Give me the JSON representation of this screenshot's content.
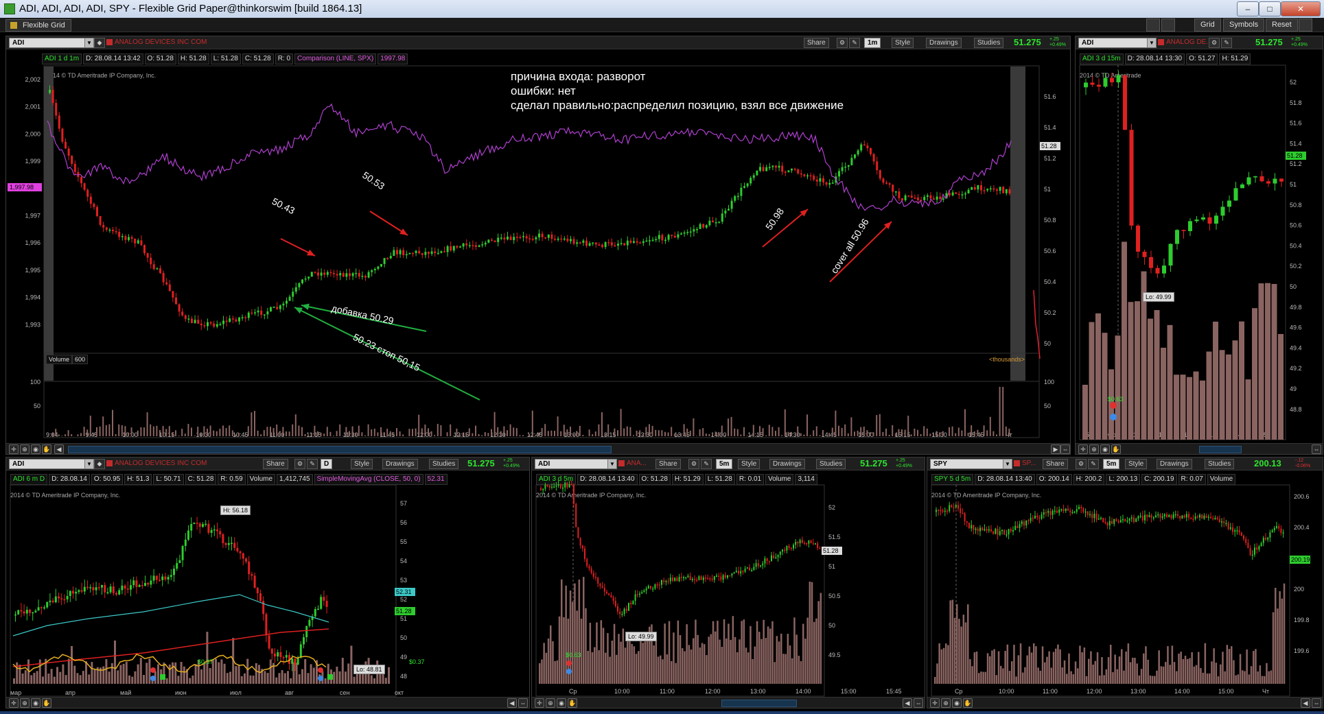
{
  "window": {
    "title": "ADI, ADI, ADI, ADI, SPY - Flexible Grid Paper@thinkorswim [build 1864.13]",
    "minimize": "–",
    "maximize": "□",
    "close": "✕",
    "icon": "thinkorswim-icon"
  },
  "toolbar": {
    "tab": "Flexible Grid",
    "buttons": [
      "Grid",
      "Symbols",
      "Reset"
    ]
  },
  "common": {
    "share": "Share",
    "style": "Style",
    "drawings": "Drawings",
    "studies": "Studies",
    "company": "ANALOG DEVICES INC COM"
  },
  "panels": {
    "main": {
      "symbol": "ADI",
      "aggregation": "1m",
      "price": "51.275",
      "change": "+.25",
      "change_pct": "+0.49%",
      "header": [
        "ADI 1 d 1m",
        "D: 28.08.14 13:42",
        "O: 51.28",
        "H: 51.28",
        "L: 51.28",
        "C: 51.28",
        "R: 0"
      ],
      "comparison": "Comparison (LINE, SPX)",
      "comparison_value": "1997.98",
      "copyright": "2014 © TD Ameritrade IP Company, Inc.",
      "left_axis": [
        "2,002",
        "2,001",
        "2,000",
        "1,999",
        "1,998",
        "1,997",
        "1,996",
        "1,995",
        "1,994",
        "1,993"
      ],
      "left_marker": "1,997.98",
      "right_axis": [
        "51.6",
        "51.4",
        "51.2",
        "51",
        "50.8",
        "50.6",
        "50.4",
        "50.2",
        "50"
      ],
      "right_marker": "51.28",
      "volume_label": "Volume",
      "volume_value": "600",
      "volume_units": "<thousands>",
      "volume_axis": [
        "100",
        "50"
      ],
      "time_axis": [
        "9:04",
        "9:45",
        "10:00",
        "10:15",
        "10:30",
        "10:45",
        "11:00",
        "11:15",
        "11:30",
        "11:45",
        "12:00",
        "12:15",
        "12:30",
        "12:45",
        "13:00",
        "13:15",
        "13:30",
        "13:45",
        "14:00",
        "14:15",
        "14:30",
        "14:45",
        "15:00",
        "15:15",
        "15:30",
        "15:45",
        "Чт"
      ],
      "annotation": [
        "причина входа: разворот",
        "ошибки: нет",
        "сделал правильно:распределил позицию, взял все движение"
      ],
      "arrow_labels": [
        "50.53",
        "50.43",
        "добавка 50.29",
        "50.23 стоп 50,15",
        "50.98",
        "cover all 50.96"
      ]
    },
    "right": {
      "symbol": "ADI",
      "company": "ANALOG DE...",
      "price": "51.275",
      "change": "+.25",
      "change_pct": "+0.49%",
      "header": [
        "ADI 3 d 15m",
        "D: 28.08.14 13:30",
        "O: 51.27",
        "H: 51.29"
      ],
      "copyright": "2014 © TD Ameritrade",
      "right_axis": [
        "52",
        "51.8",
        "51.6",
        "51.4",
        "51.2",
        "51",
        "50.8",
        "50.6",
        "50.4",
        "50.2",
        "50",
        "49.8",
        "49.6",
        "49.4",
        "49.2",
        "49",
        "48.8"
      ],
      "marker": "51.28",
      "lo": "Lo: 49.99",
      "dividend": "$0.63",
      "time_axis": [
        "15",
        "Ср",
        "10",
        "11",
        "12",
        "13",
        "14",
        "15"
      ]
    },
    "bl": {
      "symbol": "ADI",
      "aggregation": "D",
      "price": "51.275",
      "change": "+.25",
      "change_pct": "+0.49%",
      "header": [
        "ADI 6 m D",
        "D: 28.08.14",
        "O: 50.95",
        "H: 51.3",
        "L: 50.71",
        "C: 51.28",
        "R: 0.59",
        "Volume",
        "1,412,745"
      ],
      "sma": "SimpleMovingAvg (CLOSE, 50, 0)",
      "sma_value": "52.31",
      "copyright": "2014 © TD Ameritrade IP Company, Inc.",
      "right_axis": [
        "57",
        "56",
        "55",
        "54",
        "53",
        "52",
        "51",
        "50",
        "49",
        "48"
      ],
      "marker1": "52.31",
      "marker2": "51.28",
      "hi": "Hi: 56.18",
      "lo": "Lo: 48.81",
      "div1": "$0.37",
      "div2": "$0.37",
      "time_axis": [
        "мар",
        "апр",
        "май",
        "июн",
        "июл",
        "авг",
        "сен",
        "окт"
      ]
    },
    "bm": {
      "symbol": "ADI",
      "company": "ANA...",
      "aggregation": "5m",
      "price": "51.275",
      "change": "+.25",
      "change_pct": "+0.49%",
      "header": [
        "ADI 3 d 5m",
        "D: 28.08.14 13:40",
        "O: 51.28",
        "H: 51.29",
        "L: 51.28",
        "R: 0.01",
        "Volume",
        "3,114"
      ],
      "copyright": "2014 © TD Ameritrade IP Company, Inc.",
      "right_axis": [
        "52",
        "51.5",
        "51",
        "50.5",
        "50",
        "49.5"
      ],
      "marker": "51.28",
      "lo": "Lo: 49.99",
      "dividend": "$0.63",
      "time_axis": [
        "Ср",
        "10:00",
        "11:00",
        "12:00",
        "13:00",
        "14:00",
        "15:00",
        "15:45"
      ]
    },
    "br": {
      "symbol": "SPY",
      "company": "SP...",
      "aggregation": "5m",
      "price": "200.13",
      "change": "-.12",
      "change_pct": "-0.06%",
      "header": [
        "SPY 5 d 5m",
        "D: 28.08.14 13:40",
        "O: 200.14",
        "H: 200.2",
        "L: 200.13",
        "C: 200.19",
        "R: 0.07",
        "Volume"
      ],
      "copyright": "2014 © TD Ameritrade IP Company, Inc.",
      "right_axis": [
        "200.6",
        "200.4",
        "200.2",
        "200",
        "199.8",
        "199.6"
      ],
      "marker": "200.19",
      "time_axis": [
        "Ср",
        "10:00",
        "11:00",
        "12:00",
        "13:00",
        "14:00",
        "15:00",
        "Чт"
      ]
    }
  },
  "colors": {
    "up": "#2ecc2e",
    "down": "#e02020",
    "volume": "#8a6461",
    "comparison": "#b040d0",
    "sma_red": "#e02020",
    "sma_cyan": "#3cc8c8",
    "sma_yellow": "#e8b020",
    "arrow_red": "#e02020",
    "arrow_green": "#20b040"
  }
}
